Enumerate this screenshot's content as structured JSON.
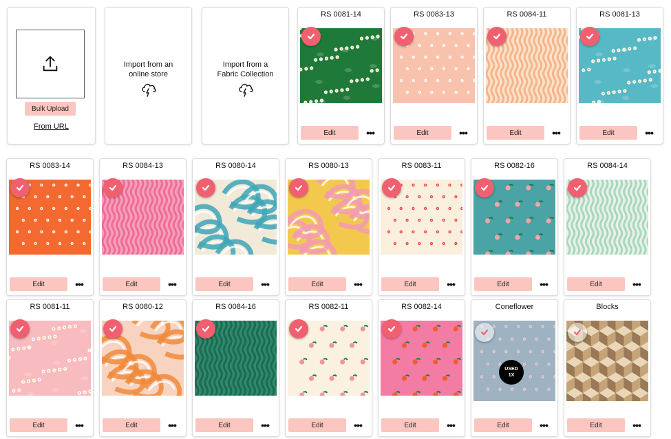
{
  "upload": {
    "bulk_upload_label": "Bulk Upload",
    "from_url_label": "From URL"
  },
  "import_store": {
    "line1": "Import from an",
    "line2": "online store"
  },
  "import_collection": {
    "line1": "Import from a",
    "line2": "Fabric Collection"
  },
  "edit_label": "Edit",
  "more_label": "•••",
  "used_badge": {
    "line1": "USED",
    "line2": "1X"
  },
  "fabrics": [
    {
      "name": "RS 0081-14",
      "bg": "#1f7a3a",
      "fg": "#ffffff",
      "pattern": "flowers",
      "status": "selected"
    },
    {
      "name": "RS 0083-13",
      "bg": "#f9c2ad",
      "fg": "#ffffff",
      "pattern": "dots",
      "status": "selected"
    },
    {
      "name": "RS 0084-11",
      "bg": "#fde1c8",
      "fg": "#f5b48a",
      "pattern": "waves",
      "status": "selected"
    },
    {
      "name": "RS 0081-13",
      "bg": "#58b9c6",
      "fg": "#ffffff",
      "pattern": "flowers",
      "status": "selected"
    },
    {
      "name": "RS 0083-14",
      "bg": "#f4692f",
      "fg": "#ffffff",
      "pattern": "dots",
      "status": "selected"
    },
    {
      "name": "RS 0084-13",
      "bg": "#f5a0b8",
      "fg": "#ee6b98",
      "pattern": "waves",
      "status": "selected"
    },
    {
      "name": "RS 0080-14",
      "bg": "#f2ead8",
      "fg": "#3da6b8",
      "pattern": "swirl",
      "status": "selected"
    },
    {
      "name": "RS 0080-13",
      "bg": "#f3c94d",
      "fg": "#f29bb3",
      "pattern": "swirl",
      "status": "selected"
    },
    {
      "name": "RS 0083-11",
      "bg": "#faeedd",
      "fg": "#e8464f",
      "pattern": "dots",
      "status": "selected"
    },
    {
      "name": "RS 0082-16",
      "bg": "#4aa3a5",
      "fg": "#f4a4a8",
      "pattern": "fruit",
      "status": "selected"
    },
    {
      "name": "RS 0084-14",
      "bg": "#e6f2e3",
      "fg": "#a8d6bf",
      "pattern": "waves",
      "status": "selected"
    },
    {
      "name": "RS 0081-11",
      "bg": "#f8bcc0",
      "fg": "#ffffff",
      "pattern": "flowers",
      "status": "selected"
    },
    {
      "name": "RS 0080-12",
      "bg": "#f7d3c0",
      "fg": "#f18a3a",
      "pattern": "swirl",
      "status": "selected"
    },
    {
      "name": "RS 0084-16",
      "bg": "#2e8a6c",
      "fg": "#1d6a52",
      "pattern": "waves",
      "status": "selected"
    },
    {
      "name": "RS 0082-11",
      "bg": "#fbf1e0",
      "fg": "#f193a5",
      "pattern": "fruit",
      "status": "selected"
    },
    {
      "name": "RS 0082-14",
      "bg": "#f27ca4",
      "fg": "#f25b2a",
      "pattern": "fruit",
      "status": "selected"
    },
    {
      "name": "Coneflower",
      "bg": "#9fb2c2",
      "fg": "#e7c9d6",
      "pattern": "dots",
      "status": "used"
    },
    {
      "name": "Blocks",
      "bg": "#c5a47a",
      "fg": "#9a7a56",
      "pattern": "blocks",
      "status": "used"
    }
  ]
}
